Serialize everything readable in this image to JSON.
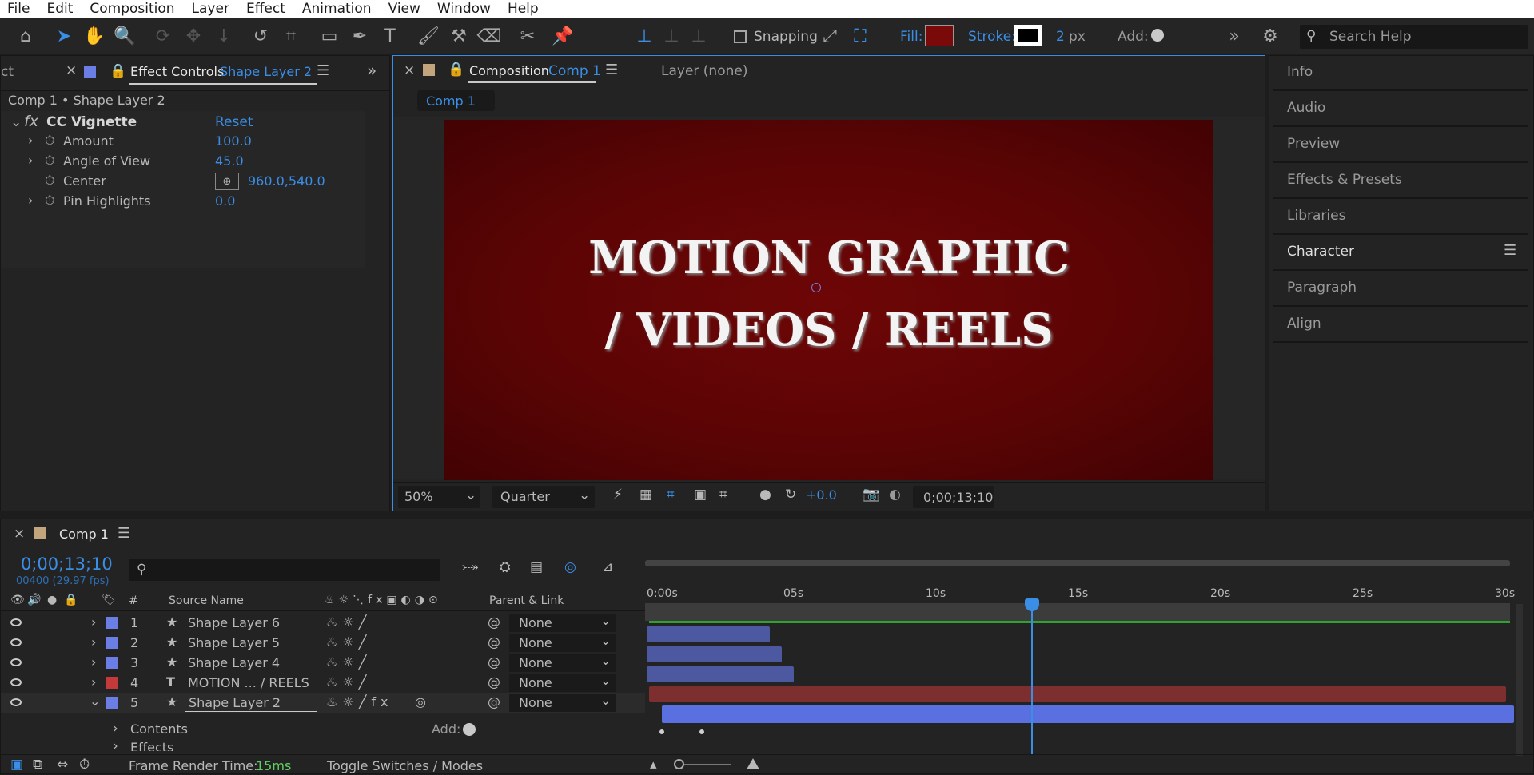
{
  "menu": [
    "File",
    "Edit",
    "Composition",
    "Layer",
    "Effect",
    "Animation",
    "View",
    "Window",
    "Help"
  ],
  "toolbar": {
    "snapping": "Snapping",
    "fill": "Fill:",
    "stroke": "Stroke:",
    "stroke_width": "2",
    "stroke_unit": "px",
    "add": "Add:",
    "search_placeholder": "Search Help",
    "colors": {
      "fill": "#7a0a0a",
      "stroke": "#000000"
    }
  },
  "effect_controls": {
    "tab_left": "ct",
    "tab": "Effect Controls",
    "tab_target": "Shape Layer 2",
    "subtitle": "Comp 1 • Shape Layer 2",
    "effect_name": "CC Vignette",
    "reset": "Reset",
    "props": [
      {
        "label": "Amount",
        "value": "100.0"
      },
      {
        "label": "Angle of View",
        "value": "45.0"
      },
      {
        "label": "Center",
        "value": "960.0,540.0"
      },
      {
        "label": "Pin Highlights",
        "value": "0.0"
      }
    ]
  },
  "composition": {
    "tab": "Composition",
    "comp_name": "Comp 1",
    "layer_tab": "Layer (none)",
    "breadcrumb": "Comp 1",
    "title_line1": "MOTION GRAPHIC",
    "title_line2": "/ VIDEOS / REELS",
    "zoom": "50%",
    "resolution": "Quarter",
    "exposure": "+0.0",
    "timecode": "0;00;13;10",
    "bg": "#5c0405"
  },
  "right_panels": [
    "Info",
    "Audio",
    "Preview",
    "Effects & Presets",
    "Libraries",
    "Character",
    "Paragraph",
    "Align"
  ],
  "timeline": {
    "tab": "Comp 1",
    "timecode": "0;00;13;10",
    "fps": "00400 (29.97 fps)",
    "col_num": "#",
    "col_source": "Source Name",
    "col_parent": "Parent & Link",
    "ruler": [
      "0:00s",
      "05s",
      "10s",
      "15s",
      "20s",
      "25s",
      "30s"
    ],
    "layers": [
      {
        "num": "1",
        "name": "Shape Layer 6",
        "parent": "None",
        "color": "#6a7ee6",
        "type": "shape"
      },
      {
        "num": "2",
        "name": "Shape Layer 5",
        "parent": "None",
        "color": "#6a7ee6",
        "type": "shape"
      },
      {
        "num": "3",
        "name": "Shape Layer 4",
        "parent": "None",
        "color": "#6a7ee6",
        "type": "shape"
      },
      {
        "num": "4",
        "name": "MOTION ... / REELS",
        "parent": "None",
        "color": "#c43a3a",
        "type": "text"
      },
      {
        "num": "5",
        "name": "Shape Layer 2",
        "parent": "None",
        "color": "#6a7ee6",
        "type": "shape"
      }
    ],
    "contents": "Contents",
    "effects": "Effects",
    "add": "Add:",
    "render_label": "Frame Render Time:",
    "render_value": "15ms",
    "toggle": "Toggle Switches / Modes"
  }
}
